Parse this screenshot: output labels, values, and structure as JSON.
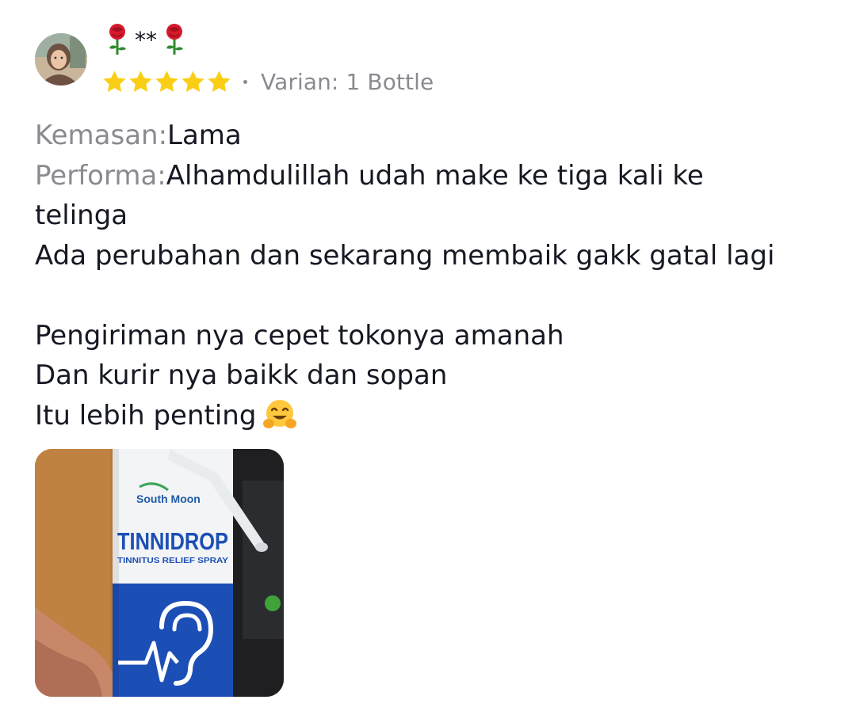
{
  "reviewer": {
    "name": "**",
    "avatar": "avatar-photo"
  },
  "rating": {
    "stars": 5,
    "max": 5,
    "color": "#FACE15"
  },
  "variant_text": "Varian: 1 Bottle",
  "review": {
    "packaging_label": "Kemasan:",
    "packaging_value": "Lama",
    "performance_label": "Performa:",
    "performance_value_line1": "Alhamdulillah udah make ke tiga kali ke",
    "performance_value_line2": "telinga",
    "line3": "Ada perubahan dan sekarang membaik gakk gatal lagi",
    "line4": "Pengiriman nya cepet tokonya amanah",
    "line5": "Dan kurir nya baikk dan sopan",
    "line6": "Itu lebih penting",
    "emoji": "hugging-face-emoji"
  },
  "photo": {
    "brand": "South Moon",
    "product_name": "TINNIDROP",
    "product_subtitle": "TINNITUS RELIEF SPRAY"
  },
  "colors": {
    "label_gray": "#8A8B91",
    "text": "#161823",
    "star": "#FACE15",
    "brand_blue": "#1D4FB8"
  }
}
